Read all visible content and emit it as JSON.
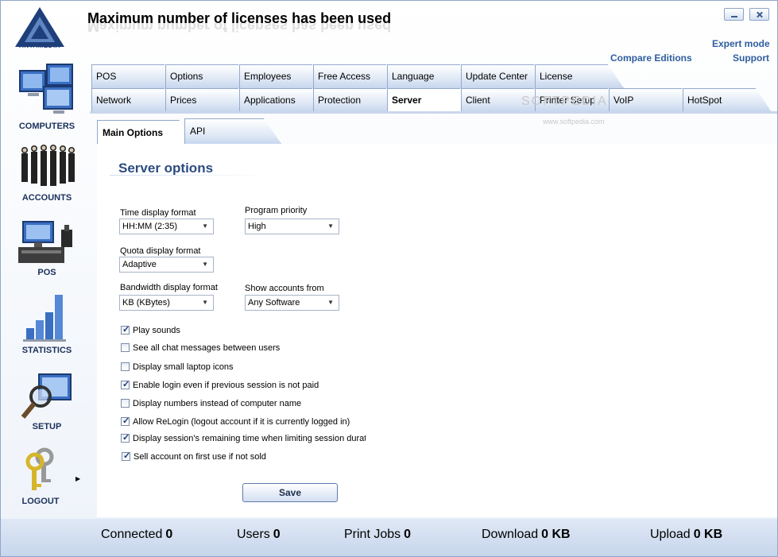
{
  "window": {
    "title": "Maximum number of licenses has been used",
    "logo_text": "ANTAMEDIA"
  },
  "header_links": {
    "expert_mode": "Expert mode",
    "compare_editions": "Compare Editions",
    "support": "Support"
  },
  "sidebar": {
    "items": [
      {
        "label": "COMPUTERS",
        "icon": "computers-icon"
      },
      {
        "label": "ACCOUNTS",
        "icon": "accounts-icon"
      },
      {
        "label": "POS",
        "icon": "pos-icon"
      },
      {
        "label": "STATISTICS",
        "icon": "statistics-icon"
      },
      {
        "label": "SETUP",
        "icon": "setup-icon"
      },
      {
        "label": "LOGOUT",
        "icon": "keys-icon"
      }
    ]
  },
  "tabs": {
    "row1": [
      "POS",
      "Options",
      "Employees",
      "Free Access",
      "Language",
      "Update Center",
      "License"
    ],
    "row2": [
      "Network",
      "Prices",
      "Applications",
      "Protection",
      "Server",
      "Client",
      "Printer Setup",
      "VoIP",
      "HotSpot"
    ],
    "active": "Server"
  },
  "subtabs": {
    "items": [
      "Main Options",
      "API"
    ],
    "active": "Main Options"
  },
  "server_options": {
    "section_title": "Server options",
    "time_display_format": {
      "label": "Time display format",
      "value": "HH:MM  (2:35)"
    },
    "program_priority": {
      "label": "Program priority",
      "value": "High"
    },
    "quota_display_format": {
      "label": "Quota display format",
      "value": "Adaptive"
    },
    "bandwidth_display_format": {
      "label": "Bandwidth display format",
      "value": "KB (KBytes)"
    },
    "show_accounts_from": {
      "label": "Show accounts from",
      "value": "Any Software"
    },
    "checkboxes": [
      {
        "label": "Play sounds",
        "checked": true
      },
      {
        "label": "See all chat messages between users",
        "checked": false
      },
      {
        "label": "Display small laptop icons",
        "checked": false
      },
      {
        "label": "Enable login even if previous session is not paid",
        "checked": true
      },
      {
        "label": "Display numbers instead of computer name",
        "checked": false
      },
      {
        "label": "Allow ReLogin (logout account if it is currently logged in)",
        "checked": true
      },
      {
        "label": "Display session's remaining time when limiting session duratio",
        "checked": true
      },
      {
        "label": "Sell account on first use if not sold",
        "checked": true
      }
    ],
    "save_label": "Save"
  },
  "status": {
    "connected_label": "Connected",
    "connected_value": "0",
    "users_label": "Users",
    "users_value": "0",
    "print_jobs_label": "Print Jobs",
    "print_jobs_value": "0",
    "download_label": "Download",
    "download_value": "0 KB",
    "upload_label": "Upload",
    "upload_value": "0 KB"
  },
  "watermark": {
    "text": "SOFTPEDIA",
    "url": "www.softpedia.com"
  }
}
